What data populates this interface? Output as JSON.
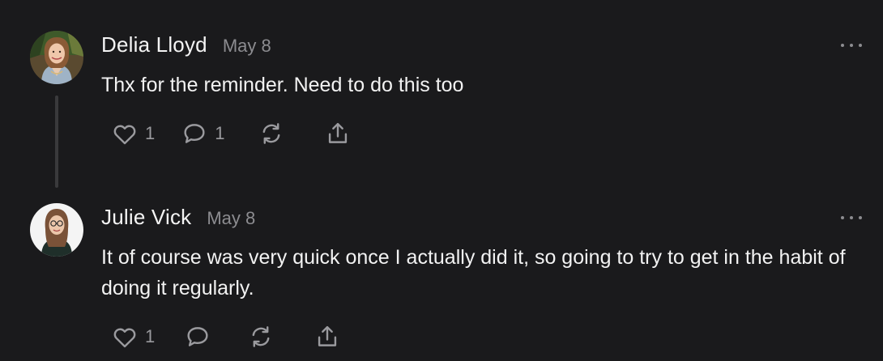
{
  "comments": [
    {
      "author": "Delia Lloyd",
      "date": "May 8",
      "text": "Thx for the reminder. Need to do this too",
      "likes": "1",
      "replies": "1"
    },
    {
      "author": "Julie Vick",
      "date": "May 8",
      "text": "It of course was very quick once I actually did it, so going to try to get in the habit of doing it regularly.",
      "likes": "1"
    }
  ],
  "icons": {
    "like": "heart-icon",
    "reply": "comment-icon",
    "restack": "restack-icon",
    "share": "share-icon",
    "more": "more-icon"
  },
  "colors": {
    "background": "#1a1a1c",
    "text": "#f2f2f2",
    "muted": "#8c8c90",
    "thread_line": "#3a3a3c"
  }
}
